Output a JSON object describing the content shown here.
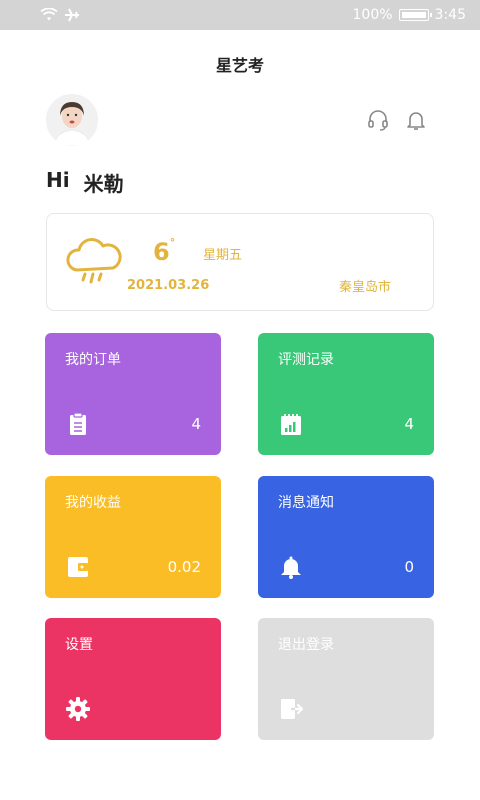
{
  "status_bar": {
    "battery": "100%",
    "time": "3:45",
    "icons": [
      "wifi-icon",
      "airplane-icon",
      "battery-icon"
    ]
  },
  "app": {
    "title": "星艺考"
  },
  "user": {
    "greeting": "Hi",
    "name": "米勒"
  },
  "weather": {
    "temperature": "6",
    "degree_symbol": "°",
    "weekday": "星期五",
    "date": "2021.03.26",
    "city": "秦皇岛市",
    "icon": "rain-cloud-icon"
  },
  "colors": {
    "accent_weather": "#e2b43d",
    "orders": "#a764de",
    "records": "#39c878",
    "earnings": "#fbbd26",
    "messages": "#3863e2",
    "settings": "#ec3464",
    "logout": "#dedede"
  },
  "cards": {
    "orders": {
      "label": "我的订单",
      "count": "4",
      "icon": "clipboard-icon"
    },
    "records": {
      "label": "评测记录",
      "count": "4",
      "icon": "chart-notebook-icon"
    },
    "earnings": {
      "label": "我的收益",
      "count": "0.02",
      "icon": "wallet-icon"
    },
    "messages": {
      "label": "消息通知",
      "count": "0",
      "icon": "bell-icon"
    },
    "settings": {
      "label": "设置",
      "icon": "gear-icon"
    },
    "logout": {
      "label": "退出登录",
      "icon": "exit-door-icon"
    }
  }
}
